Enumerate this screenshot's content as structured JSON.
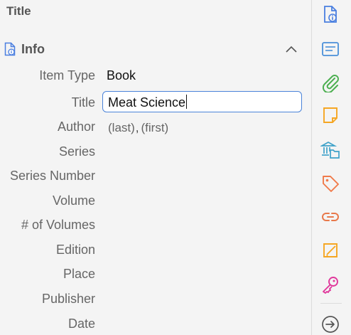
{
  "pane": {
    "title": "Title"
  },
  "section": {
    "title": "Info"
  },
  "fields": {
    "item_type": {
      "label": "Item Type",
      "value": "Book"
    },
    "title": {
      "label": "Title",
      "value": "Meat Science"
    },
    "author": {
      "label": "Author",
      "last_placeholder": "(last)",
      "separator": ",",
      "first_placeholder": "(first)"
    },
    "series": {
      "label": "Series"
    },
    "series_number": {
      "label": "Series Number"
    },
    "volume": {
      "label": "Volume"
    },
    "num_volumes": {
      "label": "# of Volumes"
    },
    "edition": {
      "label": "Edition"
    },
    "place": {
      "label": "Place"
    },
    "publisher": {
      "label": "Publisher"
    },
    "date": {
      "label": "Date"
    }
  },
  "sidenav": {
    "items": [
      {
        "icon": "info-document-icon",
        "color": "#4a7fe0"
      },
      {
        "icon": "abstract-icon",
        "color": "#4a90d9"
      },
      {
        "icon": "attachments-icon",
        "color": "#4caf50"
      },
      {
        "icon": "notes-icon",
        "color": "#f5a623"
      },
      {
        "icon": "libraries-collections-icon",
        "color": "#3fa2c9"
      },
      {
        "icon": "tags-icon",
        "color": "#f07a4a"
      },
      {
        "icon": "related-icon",
        "color": "#e8784a"
      },
      {
        "icon": "annotations-icon",
        "color": "#f5a623"
      },
      {
        "icon": "locate-key-icon",
        "color": "#e0379b"
      },
      {
        "icon": "locate-arrow-icon",
        "color": "#555555"
      }
    ]
  }
}
